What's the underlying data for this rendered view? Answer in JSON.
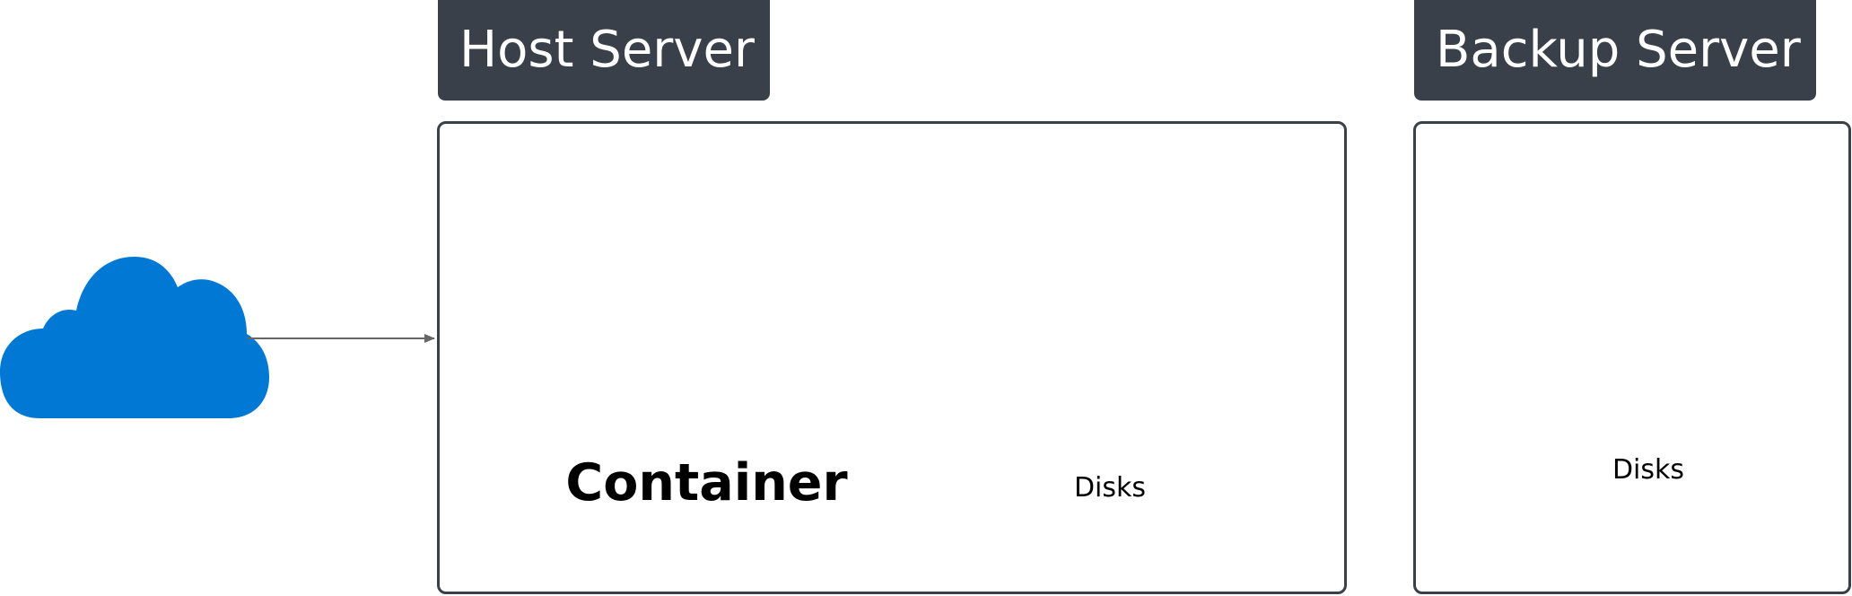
{
  "host": {
    "title": "Host Server",
    "container_label": "Container",
    "disks_label": "Disks"
  },
  "backup": {
    "title": "Backup Server",
    "disks_label": "Disks"
  },
  "icons": {
    "source": "cloud-icon",
    "container": "container-registry-icon",
    "disks": "disk-stack-icon"
  },
  "colors": {
    "header": "#394049",
    "cloud": "#0078D4",
    "container_cloud": "#59B4D9",
    "container_box": "#804998",
    "disk_top": "#5EA0EF",
    "disk_top_side": "#0078D4",
    "disk_bottom": "#76BC2D",
    "disk_bottom_side": "#5E9624"
  }
}
